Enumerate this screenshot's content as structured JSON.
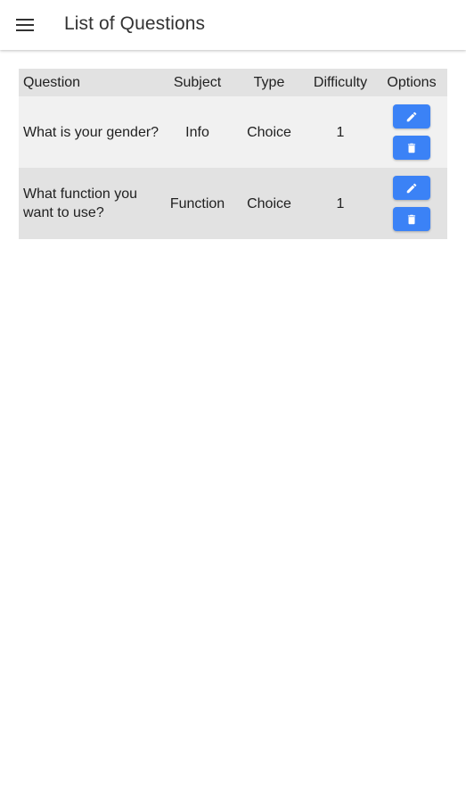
{
  "app_bar": {
    "title": "List of Questions",
    "menu_icon": "hamburger-menu-icon"
  },
  "table": {
    "headers": {
      "question": "Question",
      "subject": "Subject",
      "type": "Type",
      "difficulty": "Difficulty",
      "options": "Options"
    },
    "rows": [
      {
        "question": "What is your gender?",
        "subject": "Info",
        "type": "Choice",
        "difficulty": "1",
        "edit_icon": "pencil-icon",
        "delete_icon": "trash-icon"
      },
      {
        "question": "What function you want to use?",
        "subject": "Function",
        "type": "Choice",
        "difficulty": "1",
        "edit_icon": "pencil-icon",
        "delete_icon": "trash-icon"
      }
    ]
  },
  "colors": {
    "button": "#3b82f6",
    "header_row": "#e2e2e2",
    "row_light": "#f1f1f1",
    "row_dark": "#e2e2e2"
  }
}
